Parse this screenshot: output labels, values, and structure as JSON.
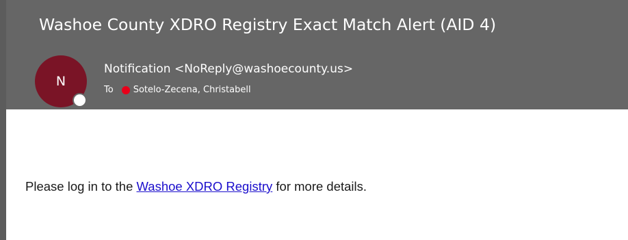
{
  "email": {
    "subject": "Washoe County XDRO Registry Exact Match Alert (AID 4)",
    "sender": {
      "initial": "N",
      "display": "Notification <NoReply@washoecounty.us>",
      "avatar_color": "#7a1426"
    },
    "recipient": {
      "to_label": "To",
      "name": "Sotelo-Zecena, Christabell",
      "status_color": "#e8001a"
    },
    "body": {
      "prefix": "Please log in to the ",
      "link_text": "Washoe XDRO Registry",
      "suffix": " for more details."
    }
  },
  "icons": {
    "avatar_presence": "presence-status-icon",
    "recipient_presence": "recipient-status-icon"
  },
  "colors": {
    "header_bg": "#666666",
    "link": "#1a0dcc"
  }
}
